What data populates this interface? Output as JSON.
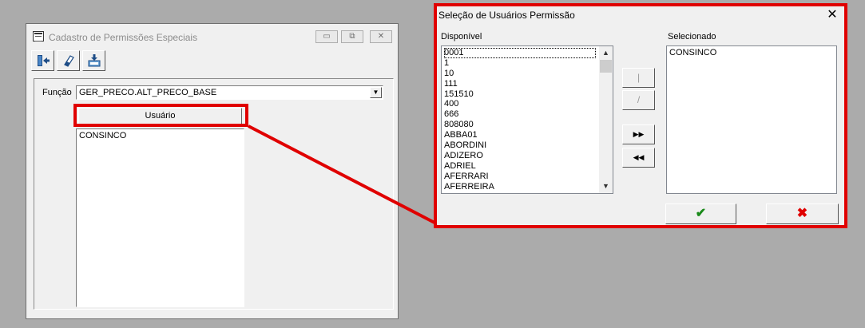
{
  "main_window": {
    "title": "Cadastro de Permissões Especiais",
    "window_buttons": [
      "▭",
      "⧉",
      "✕"
    ],
    "toolbar": [
      "exit-icon",
      "eraser-icon",
      "save-icon"
    ],
    "funcao_label": "Função",
    "funcao_value": "GER_PRECO.ALT_PRECO_BASE",
    "column_header": "Usuário",
    "users": [
      "CONSINCO"
    ]
  },
  "dialog": {
    "title": "Seleção de Usuários Permissão",
    "close": "✕",
    "available_label": "Disponível",
    "selected_label": "Selecionado",
    "available": [
      "0001",
      "1",
      "10",
      "111",
      "151510",
      "400",
      "666",
      "808080",
      "ABBA01",
      "ABORDINI",
      "ADIZERO",
      "ADRIEL",
      "AFERRARI",
      "AFERREIRA"
    ],
    "selected": [
      "CONSINCO"
    ],
    "buttons": {
      "add_one": "|",
      "remove_one": "/",
      "add_all": "▶▶",
      "remove_all": "◀◀",
      "ok": "✔",
      "cancel": "✖"
    }
  },
  "colors": {
    "highlight": "#e00000",
    "ok_check": "#1a8a1a",
    "cancel_x": "#e00000"
  }
}
